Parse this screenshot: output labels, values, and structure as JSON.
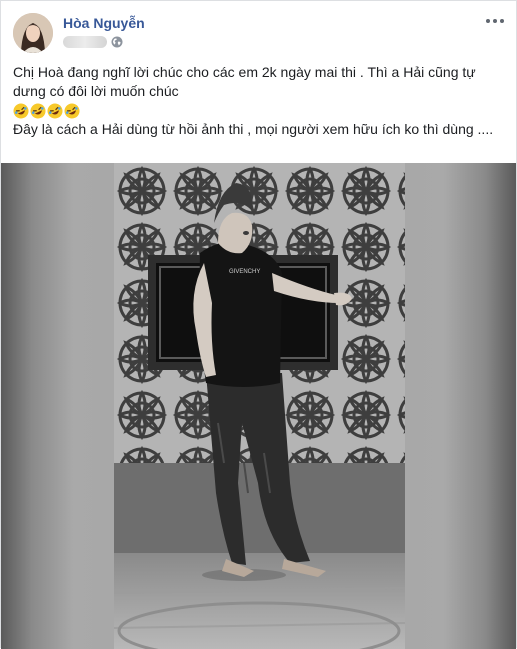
{
  "post": {
    "author": "Hòa Nguyễn",
    "privacy_icon": "globe-icon",
    "more_icon": "more-horizontal-icon",
    "text_line_1": "Chị Hoà đang nghĩ lời chúc cho các em 2k ngày mai thi . Thì a Hải cũng tự dưng có đôi lời muốn chúc",
    "emojis": [
      "rolling-on-floor-laughing-emoji",
      "rolling-on-floor-laughing-emoji",
      "rolling-on-floor-laughing-emoji",
      "rolling-on-floor-laughing-emoji"
    ],
    "text_line_2": "Đây là cách a Hải dùng từ hồi ảnh thi , mọi người xem hữu ích ko thì dùng ....",
    "video_print_text": "GIVENCHY"
  },
  "colors": {
    "author": "#385898",
    "text": "#1c1e21",
    "emoji": "#f7c92b",
    "border": "#dddfe2"
  }
}
